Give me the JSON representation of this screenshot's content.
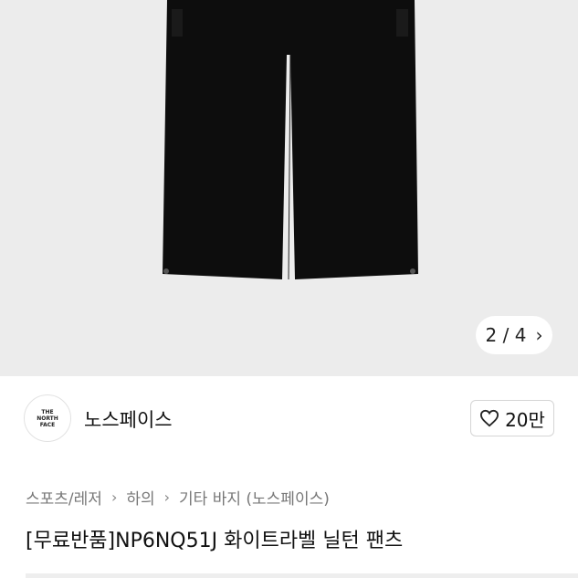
{
  "gallery": {
    "current": "2",
    "total": "4",
    "separator": "/"
  },
  "brand": {
    "logo_lines": [
      "THE",
      "NORTH",
      "FACE"
    ],
    "name": "노스페이스",
    "likes": "20만"
  },
  "breadcrumb": {
    "items": [
      "스포츠/레저",
      "하의",
      "기타 바지 (노스페이스)"
    ]
  },
  "product": {
    "title": "[무료반품]NP6NQ51J 화이트라벨 닐턴 팬츠"
  },
  "colors": {
    "hero_bg": "#ececec",
    "pants": "#0d0d0d"
  },
  "icons": {
    "next": "chevron-right-icon",
    "like": "heart-outline-icon"
  }
}
